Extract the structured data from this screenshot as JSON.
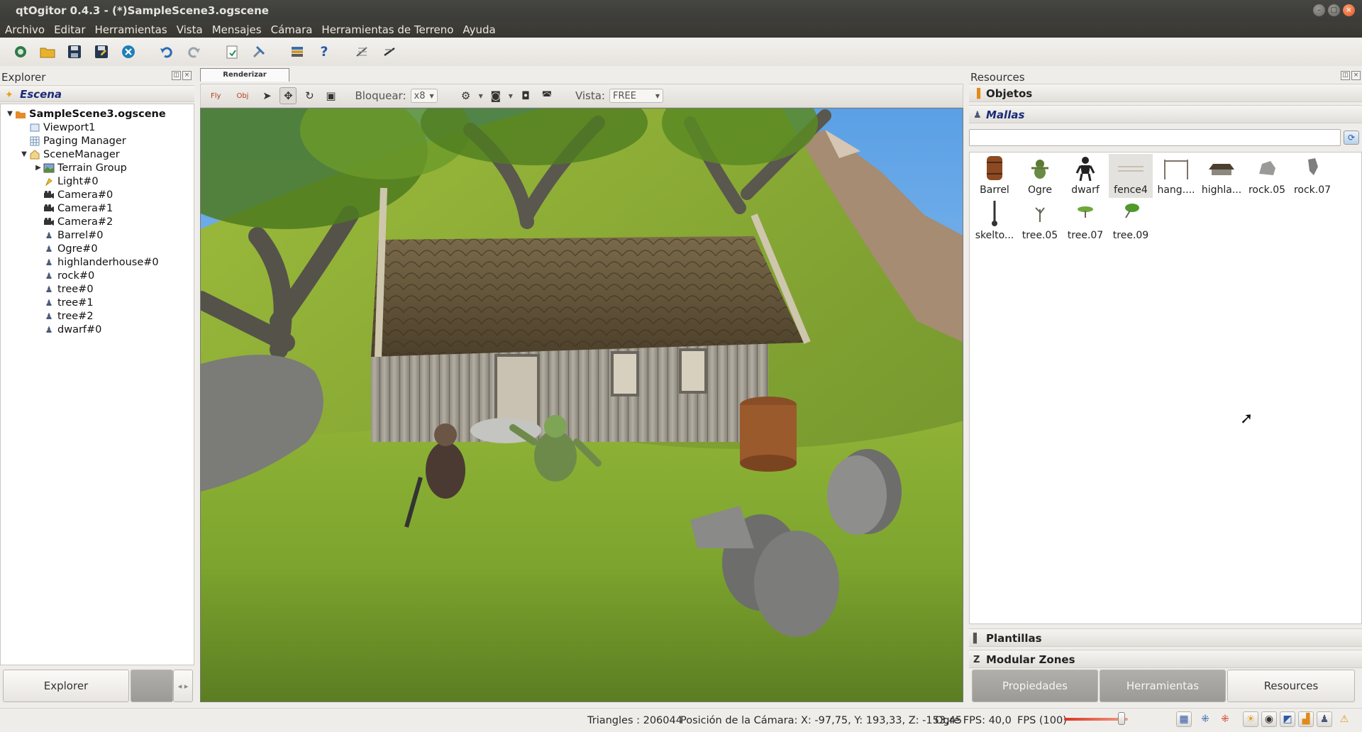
{
  "window": {
    "title": "qtOgitor 0.4.3 - (*)SampleScene3.ogscene"
  },
  "menu": [
    "Archivo",
    "Editar",
    "Herramientas",
    "Vista",
    "Mensajes",
    "Cámara",
    "Herramientas de Terreno",
    "Ayuda"
  ],
  "toolbar": {
    "icons": [
      "new-scene-icon",
      "open-folder-icon",
      "save-icon",
      "save-as-icon",
      "close-scene-icon",
      "undo-icon",
      "redo-icon",
      "import-icon",
      "settings-icon",
      "plugins-icon",
      "help-icon",
      "terrain-edit-icon",
      "terrain-tool-icon"
    ],
    "help_label": "?"
  },
  "explorer": {
    "title": "Explorer",
    "scene_label": "Escena",
    "tree": [
      {
        "label": "SampleScene3.ogscene",
        "level": 0,
        "arrow": "▼",
        "icon": "folder"
      },
      {
        "label": "Viewport1",
        "level": 1,
        "arrow": "",
        "icon": "viewport"
      },
      {
        "label": "Paging Manager",
        "level": 1,
        "arrow": "",
        "icon": "grid"
      },
      {
        "label": "SceneManager",
        "level": 1,
        "arrow": "▼",
        "icon": "scene"
      },
      {
        "label": "Terrain Group",
        "level": 2,
        "arrow": "▶",
        "icon": "terrain"
      },
      {
        "label": "Light#0",
        "level": 2,
        "arrow": "",
        "icon": "light"
      },
      {
        "label": "Camera#0",
        "level": 2,
        "arrow": "",
        "icon": "camera"
      },
      {
        "label": "Camera#1",
        "level": 2,
        "arrow": "",
        "icon": "camera"
      },
      {
        "label": "Camera#2",
        "level": 2,
        "arrow": "",
        "icon": "camera"
      },
      {
        "label": "Barrel#0",
        "level": 2,
        "arrow": "",
        "icon": "entity"
      },
      {
        "label": "Ogre#0",
        "level": 2,
        "arrow": "",
        "icon": "entity"
      },
      {
        "label": "highlanderhouse#0",
        "level": 2,
        "arrow": "",
        "icon": "entity"
      },
      {
        "label": "rock#0",
        "level": 2,
        "arrow": "",
        "icon": "entity"
      },
      {
        "label": "tree#0",
        "level": 2,
        "arrow": "",
        "icon": "entity"
      },
      {
        "label": "tree#1",
        "level": 2,
        "arrow": "",
        "icon": "entity"
      },
      {
        "label": "tree#2",
        "level": 2,
        "arrow": "",
        "icon": "entity"
      },
      {
        "label": "dwarf#0",
        "level": 2,
        "arrow": "",
        "icon": "entity"
      }
    ],
    "bottom_tabs": [
      "Explorer",
      ""
    ]
  },
  "viewport": {
    "tab_label": "Renderizar",
    "fly_label": "Fly",
    "obj_label": "Obj",
    "lock_label": "Bloquear:",
    "lock_value": "x8",
    "view_label": "Vista:",
    "view_value": "FREE"
  },
  "resources": {
    "title": "Resources",
    "sections": {
      "objects": "Objetos",
      "meshes": "Mallas",
      "templates": "Plantillas",
      "zones": "Modular Zones"
    },
    "search_placeholder": "",
    "meshes": [
      {
        "name": "Barrel",
        "icon": "barrel"
      },
      {
        "name": "Ogre",
        "icon": "ogre"
      },
      {
        "name": "dwarf",
        "icon": "dwarf"
      },
      {
        "name": "fence4",
        "icon": "fence"
      },
      {
        "name": "hang....",
        "icon": "hang"
      },
      {
        "name": "highla...",
        "icon": "house"
      },
      {
        "name": "rock.05",
        "icon": "rock"
      },
      {
        "name": "rock.07",
        "icon": "rock2"
      },
      {
        "name": "skelto...",
        "icon": "skeleton"
      },
      {
        "name": "tree.05",
        "icon": "tree"
      },
      {
        "name": "tree.07",
        "icon": "tree2"
      },
      {
        "name": "tree.09",
        "icon": "tree3"
      }
    ],
    "selected_mesh": 3,
    "bottom_tabs": [
      "Propiedades",
      "Herramientas",
      "Resources"
    ]
  },
  "status": {
    "triangles": "Triangles : 206044",
    "camera_position": "Posición de la Cámara: X: -97,75, Y:  193,33, Z: -153,45",
    "fps": "Ogre FPS: 40,0",
    "fps_limit": "FPS (100)",
    "fps_limit_fraction": 0.9
  },
  "colors": {
    "accent": "#e2541e",
    "scene_label": "#1a2a7a",
    "selection": "#e4e2de"
  }
}
